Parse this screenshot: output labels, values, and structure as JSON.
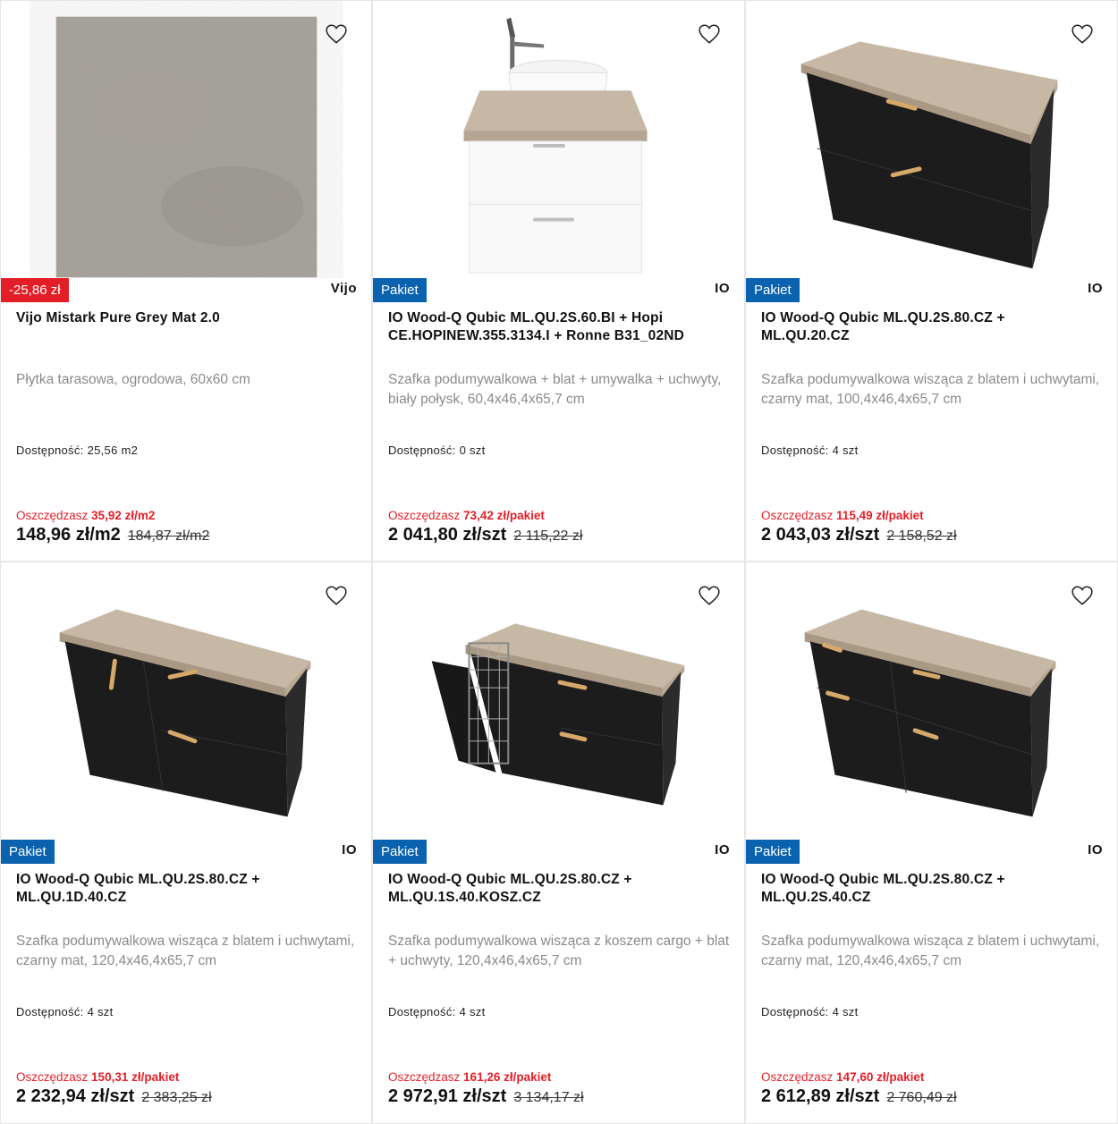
{
  "products": [
    {
      "badge": "-25,86 zł",
      "badge_type": "sale",
      "brand": "Vijo",
      "title": "Vijo Mistark Pure Grey Mat 2.0",
      "description": "Płytka tarasowa, ogrodowa, 60x60 cm",
      "availability_label": "Dostępność:",
      "availability_value": "25,56 m2",
      "save_label": "Oszczędzasz",
      "save_value": "35,92 zł/m2",
      "price": "148,96 zł/m2",
      "old_price": "184,87 zł/m2",
      "image": "tile-image"
    },
    {
      "badge": "Pakiet",
      "badge_type": "pack",
      "brand": "IO",
      "title": "IO Wood-Q Qubic ML.QU.2S.60.BI + Hopi CE.HOPINEW.355.3134.I + Ronne B31_02ND",
      "description": "Szafka podumywalkowa + blat + umywalka + uchwyty, biały połysk, 60,4x46,4x65,7 cm",
      "availability_label": "Dostępność:",
      "availability_value": "0 szt",
      "save_label": "Oszczędzasz",
      "save_value": "73,42 zł/pakiet",
      "price": "2 041,80 zł/szt",
      "old_price": "2 115,22 zł",
      "image": "white-vanity-image"
    },
    {
      "badge": "Pakiet",
      "badge_type": "pack",
      "brand": "IO",
      "title": "IO Wood-Q Qubic ML.QU.2S.80.CZ + ML.QU.20.CZ",
      "description": "Szafka podumywalkowa wisząca z blatem i uchwytami, czarny mat, 100,4x46,4x65,7 cm",
      "availability_label": "Dostępność:",
      "availability_value": "4 szt",
      "save_label": "Oszczędzasz",
      "save_value": "115,49 zł/pakiet",
      "price": "2 043,03 zł/szt",
      "old_price": "2 158,52 zł",
      "image": "black-cabinet-image"
    },
    {
      "badge": "Pakiet",
      "badge_type": "pack",
      "brand": "IO",
      "title": "IO Wood-Q Qubic ML.QU.2S.80.CZ + ML.QU.1D.40.CZ",
      "description": "Szafka podumywalkowa wisząca z blatem i uchwytami, czarny mat, 120,4x46,4x65,7 cm",
      "availability_label": "Dostępność:",
      "availability_value": "4 szt",
      "save_label": "Oszczędzasz",
      "save_value": "150,31 zł/pakiet",
      "price": "2 232,94 zł/szt",
      "old_price": "2 383,25 zł",
      "image": "black-cabinet-door-image"
    },
    {
      "badge": "Pakiet",
      "badge_type": "pack",
      "brand": "IO",
      "title": "IO Wood-Q Qubic ML.QU.2S.80.CZ + ML.QU.1S.40.KOSZ.CZ",
      "description": "Szafka podumywalkowa wisząca z koszem cargo + blat + uchwyty, 120,4x46,4x65,7 cm",
      "availability_label": "Dostępność:",
      "availability_value": "4 szt",
      "save_label": "Oszczędzasz",
      "save_value": "161,26 zł/pakiet",
      "price": "2 972,91 zł/szt",
      "old_price": "3 134,17 zł",
      "image": "black-cabinet-cargo-image"
    },
    {
      "badge": "Pakiet",
      "badge_type": "pack",
      "brand": "IO",
      "title": "IO Wood-Q Qubic ML.QU.2S.80.CZ + ML.QU.2S.40.CZ",
      "description": "Szafka podumywalkowa wisząca z blatem i uchwytami, czarny mat, 120,4x46,4x65,7 cm",
      "availability_label": "Dostępność:",
      "availability_value": "4 szt",
      "save_label": "Oszczędzasz",
      "save_value": "147,60 zł/pakiet",
      "price": "2 612,89 zł/szt",
      "old_price": "2 760,49 zł",
      "image": "black-cabinet-4drawer-image"
    }
  ],
  "colors": {
    "sale_red": "#e41e26",
    "pack_blue": "#0b63b0",
    "cabinet_black": "#1c1c1c",
    "worktop_oak": "#c7b8a6",
    "handle_gold": "#d6a86a"
  }
}
